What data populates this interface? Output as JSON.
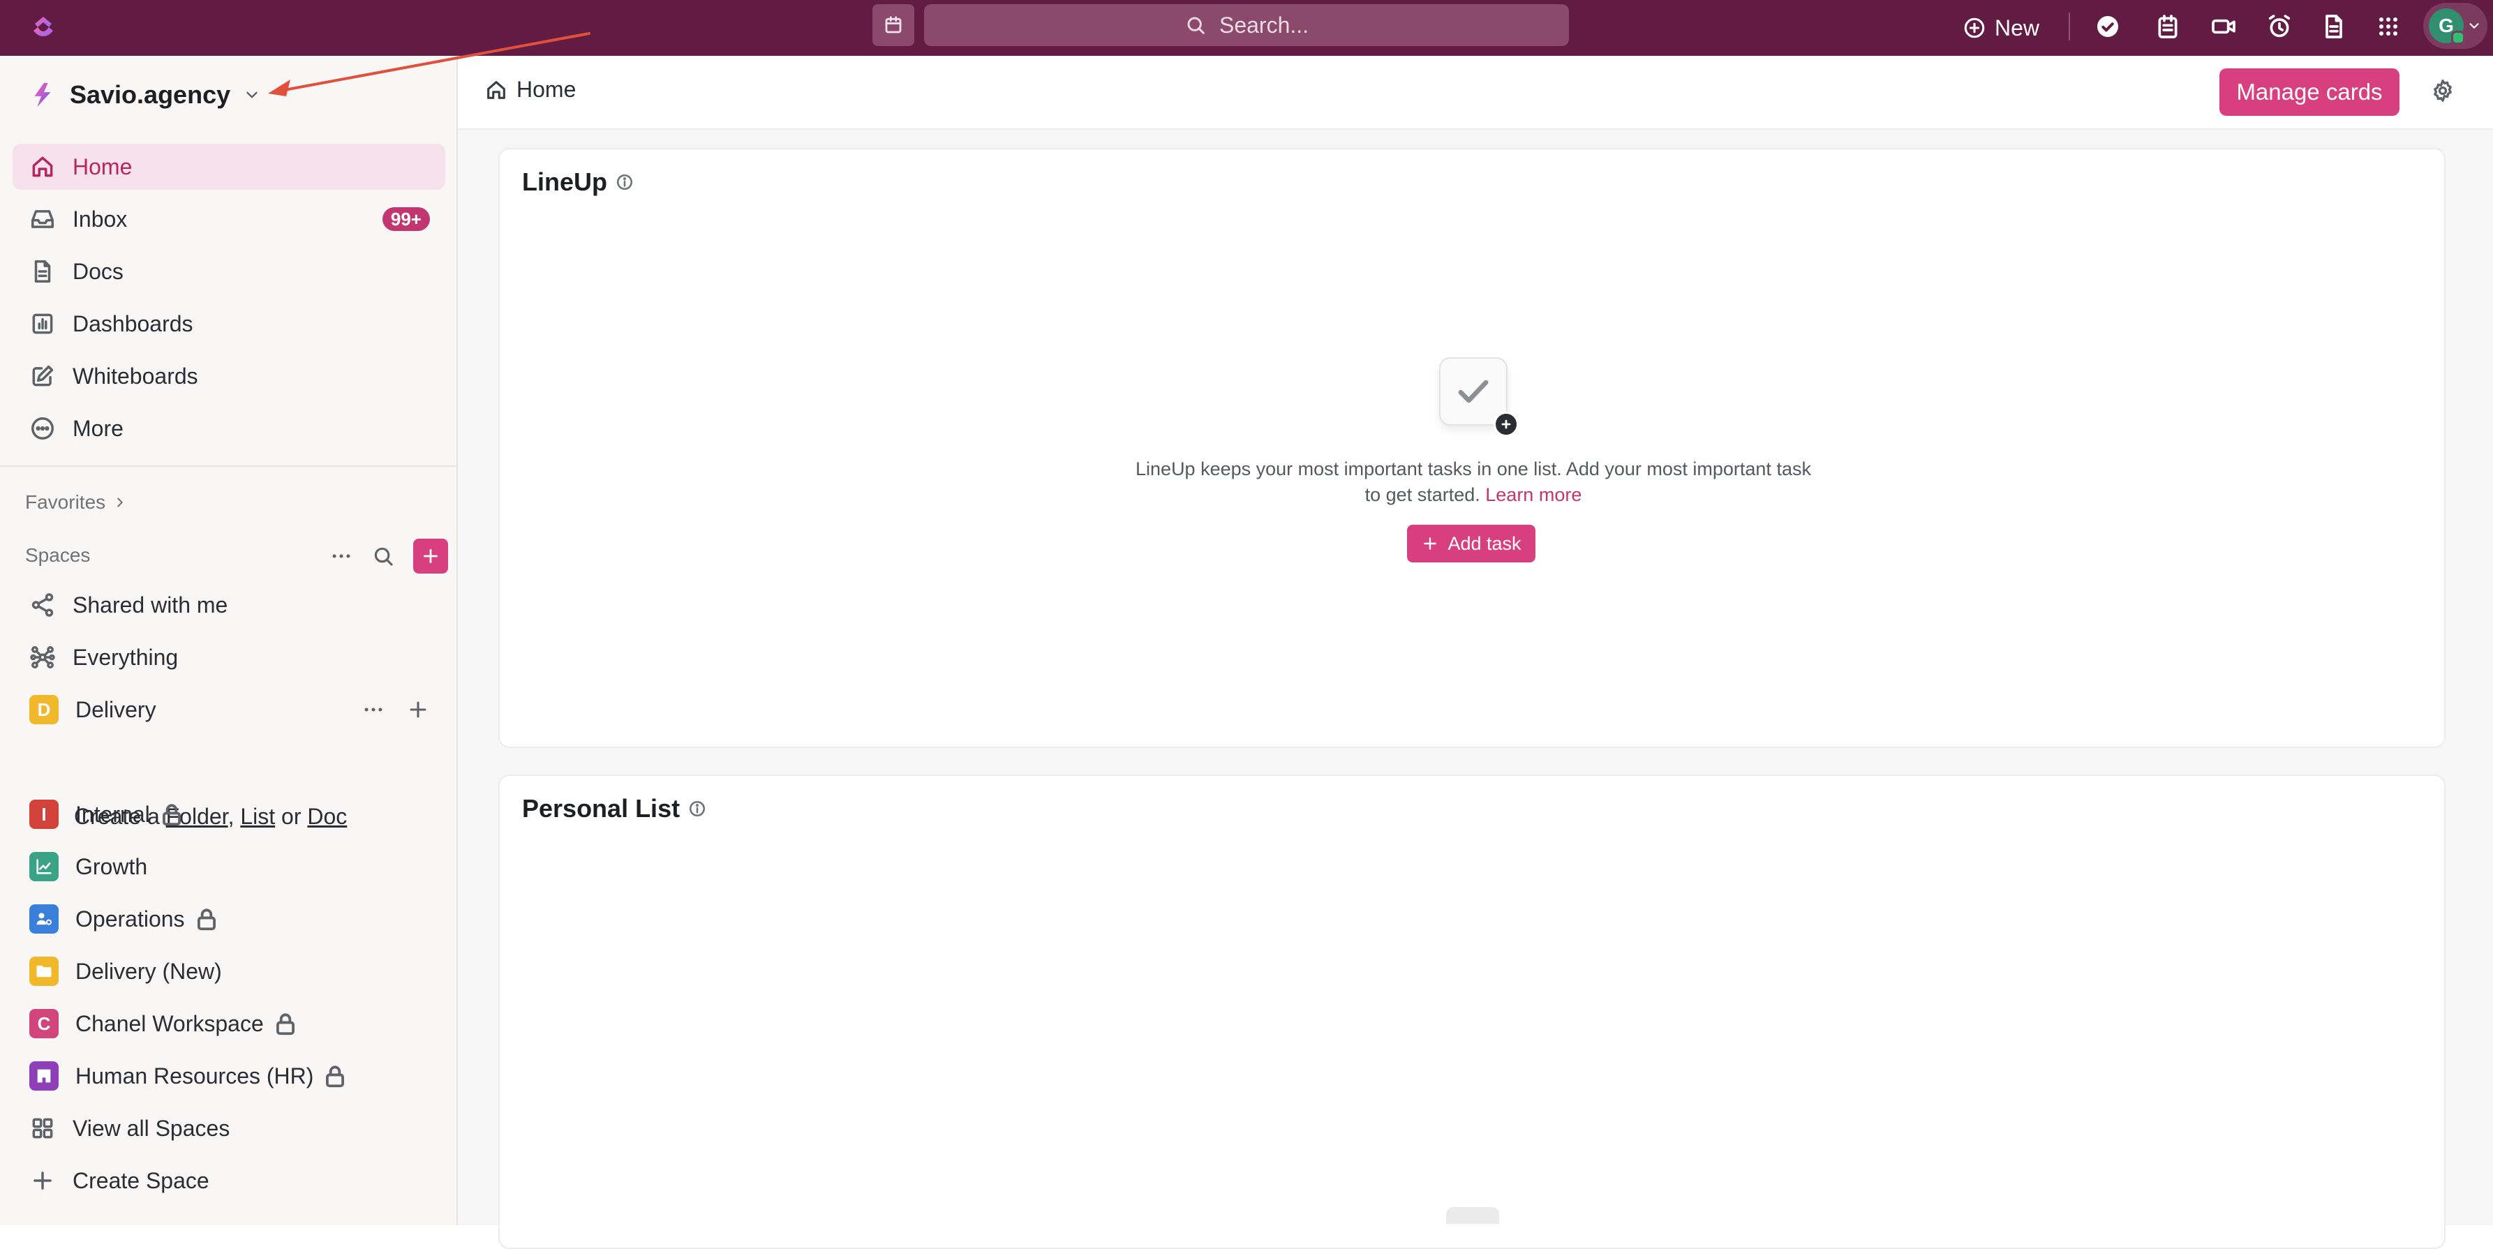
{
  "topbar": {
    "search_placeholder": "Search...",
    "new_label": "New",
    "avatar_initial": "G",
    "brand_color": "#621b42",
    "accent_color": "#d73f7e",
    "icons": [
      "calendar-icon",
      "check-circle-icon",
      "notepad-icon",
      "video-icon",
      "alarm-icon",
      "document-icon",
      "apps-grid-icon"
    ]
  },
  "workspace": {
    "name": "Savio.agency"
  },
  "sidebar": {
    "nav": [
      {
        "label": "Home",
        "icon": "home-icon",
        "active": true
      },
      {
        "label": "Inbox",
        "icon": "inbox-icon",
        "badge": "99+"
      },
      {
        "label": "Docs",
        "icon": "docs-icon"
      },
      {
        "label": "Dashboards",
        "icon": "dashboard-icon"
      },
      {
        "label": "Whiteboards",
        "icon": "whiteboard-icon"
      },
      {
        "label": "More",
        "icon": "more-circle-icon"
      }
    ],
    "favorites_label": "Favorites",
    "spaces_label": "Spaces",
    "shared_label": "Shared with me",
    "everything_label": "Everything",
    "spaces": [
      {
        "name": "Delivery",
        "initial": "D",
        "color": "#f2b82c"
      },
      {
        "name": "Internal",
        "initial": "I",
        "color": "#d3423a",
        "private": true
      },
      {
        "name": "Growth",
        "icon": "chart-line-icon",
        "color": "#3aa386"
      },
      {
        "name": "Operations",
        "icon": "users-gear-icon",
        "color": "#3a7fd9",
        "private": true
      },
      {
        "name": "Delivery (New)",
        "icon": "folder-icon",
        "color": "#f2b82c"
      },
      {
        "name": "Chanel Workspace",
        "initial": "C",
        "color": "#d2447c",
        "private": true
      },
      {
        "name": "Human Resources (HR)",
        "icon": "building-icon",
        "color": "#8e3fb8",
        "private": true
      }
    ],
    "create_line": {
      "prefix": "Create a",
      "folder": "Folder",
      "sep1": ",",
      "list": "List",
      "or": "or",
      "doc": "Doc"
    },
    "view_all_label": "View all Spaces",
    "create_space_label": "Create Space"
  },
  "main": {
    "breadcrumb": "Home",
    "manage_cards_label": "Manage cards",
    "lineup": {
      "title": "LineUp",
      "description": "LineUp keeps your most important tasks in one list. Add your most important task to get started.",
      "learn_more": "Learn more",
      "add_task_label": "Add task"
    },
    "personal_list": {
      "title": "Personal List"
    }
  }
}
